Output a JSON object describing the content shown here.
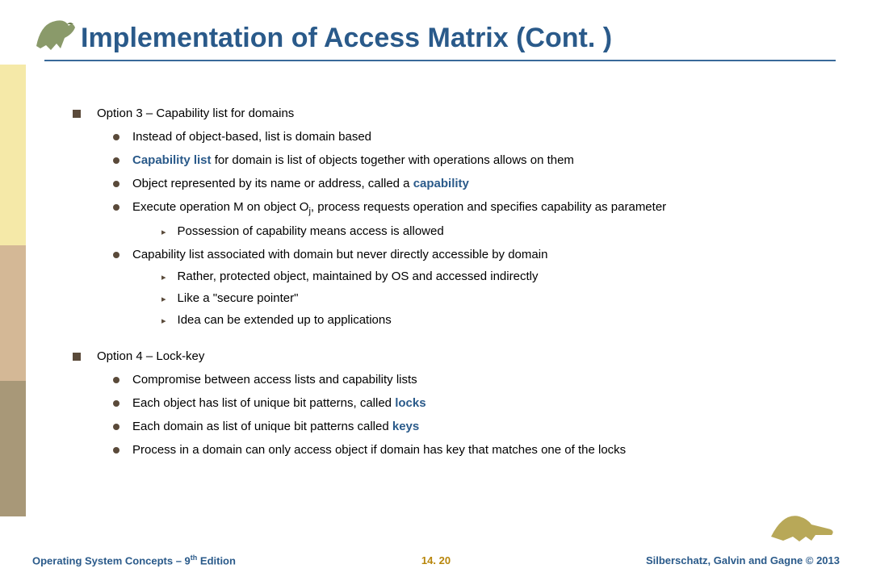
{
  "title": "Implementation of Access Matrix (Cont. )",
  "option3": {
    "heading": "Option 3 – Capability list for domains",
    "b1": "Instead of object-based, list is domain based",
    "b2a": "Capability list",
    "b2b": " for domain is list of objects together with operations allows on them",
    "b3a": "Object represented by its name or address, called a ",
    "b3b": "capability",
    "b4a": "Execute operation M on object O",
    "b4sub": "j",
    "b4b": ", process requests operation and specifies capability as parameter",
    "b4s1": "Possession of capability means access is allowed",
    "b5": "Capability list associated with domain but never directly accessible by domain",
    "b5s1": "Rather, protected object, maintained by OS and accessed indirectly",
    "b5s2": "Like a \"secure pointer\"",
    "b5s3": "Idea can be extended up to applications"
  },
  "option4": {
    "heading": "Option 4 – Lock-key",
    "b1": "Compromise between access lists and capability lists",
    "b2a": "Each object has list of unique bit patterns, called ",
    "b2b": "locks",
    "b3a": "Each domain as list of unique bit patterns called ",
    "b3b": "keys",
    "b4": "Process in a domain can only access object if domain has key that matches one of the locks"
  },
  "footer": {
    "left_a": "Operating System Concepts – 9",
    "left_sup": "th",
    "left_b": " Edition",
    "center": "14. 20",
    "right": "Silberschatz, Galvin and Gagne © 2013"
  }
}
